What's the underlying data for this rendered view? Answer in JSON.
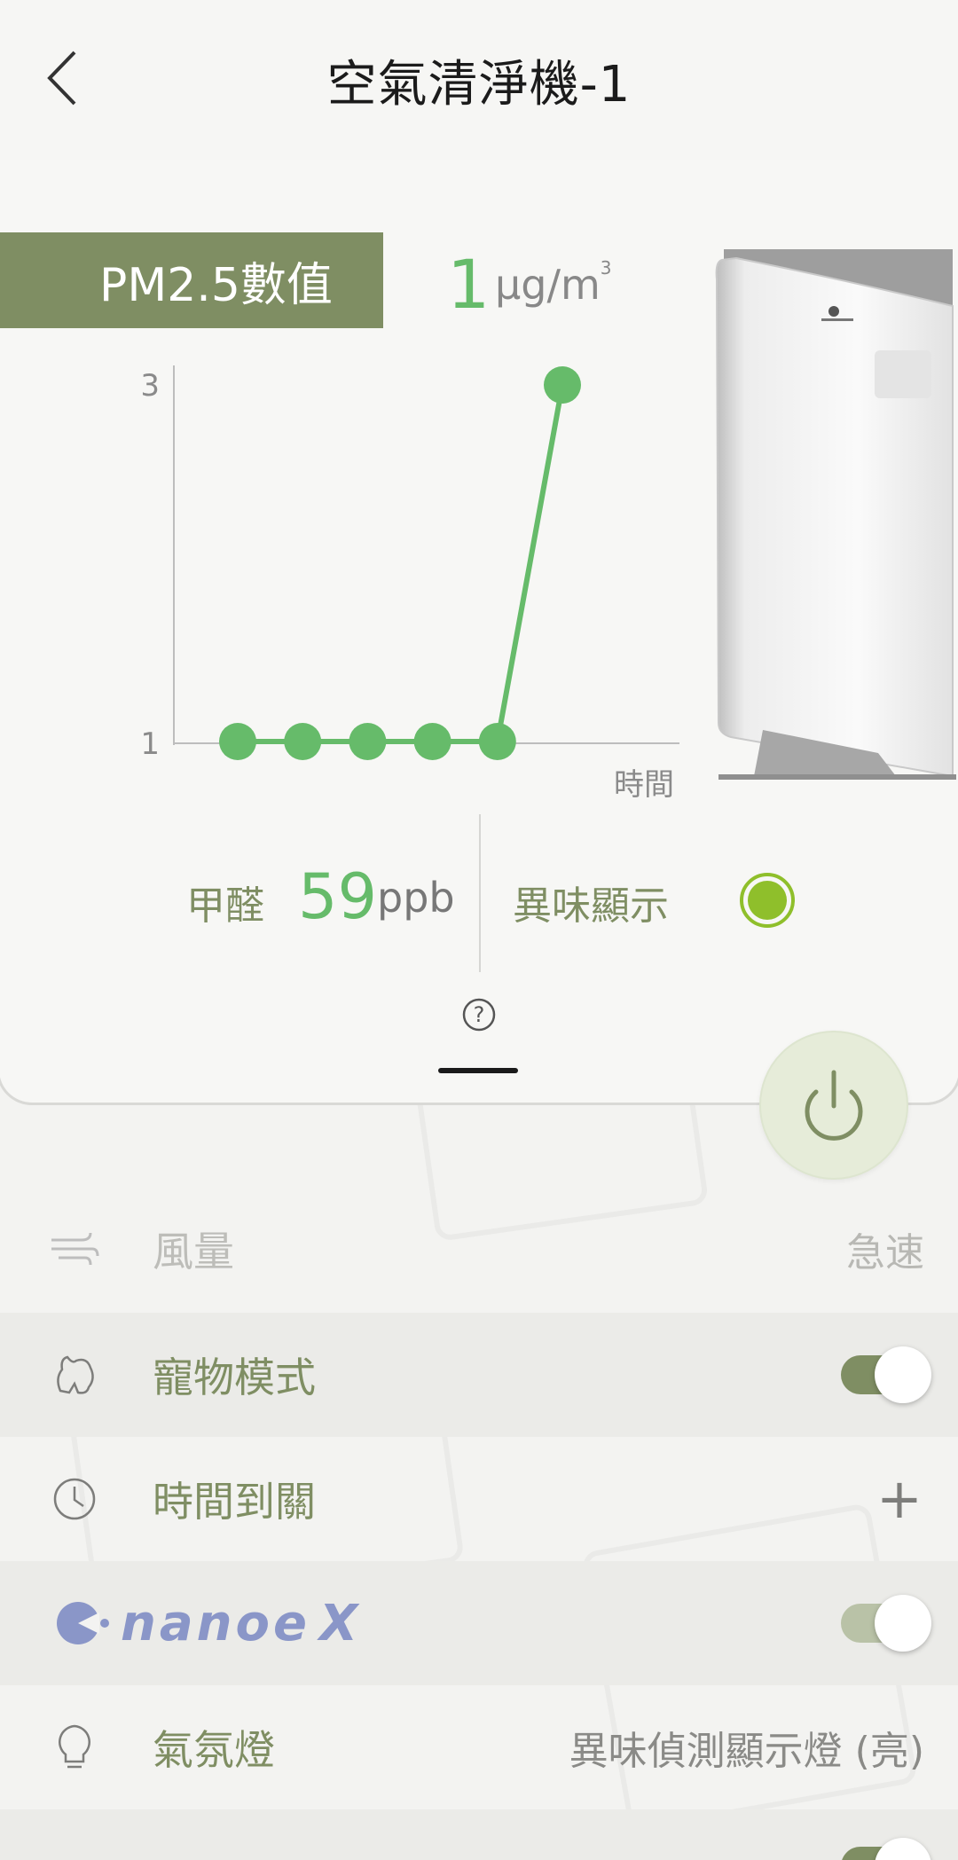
{
  "header": {
    "title": "空氣清淨機-1"
  },
  "pm25": {
    "label": "PM2.5數值",
    "value": "1",
    "unit": "µg/m",
    "unit_sup": "3"
  },
  "chart_data": {
    "type": "line",
    "x": [
      1,
      2,
      3,
      4,
      5,
      6
    ],
    "values": [
      1,
      1,
      1,
      1,
      1,
      3
    ],
    "xlabel": "時間",
    "ylabel": "",
    "yticks": [
      "3",
      "1"
    ],
    "ylim": [
      1,
      3
    ],
    "color": "#66bb6a"
  },
  "sensors": {
    "hcho_label": "甲醛",
    "hcho_value": "59",
    "hcho_unit": "ppb",
    "odor_label": "異味顯示",
    "odor_color": "#8fbf2b"
  },
  "controls": {
    "airflow_label": "風量",
    "airflow_value": "急速",
    "pet_mode_label": "寵物模式",
    "pet_mode_on": true,
    "timer_label": "時間到關",
    "nanoe_brand": "nanoe",
    "nanoe_on": true,
    "ambient_light_label": "氣氛燈",
    "ambient_light_value": "異味偵測顯示燈 (亮)"
  },
  "colors": {
    "accent": "#7f8e63",
    "data_green": "#66bb6a",
    "nanoe_blue": "#8a96c8"
  }
}
